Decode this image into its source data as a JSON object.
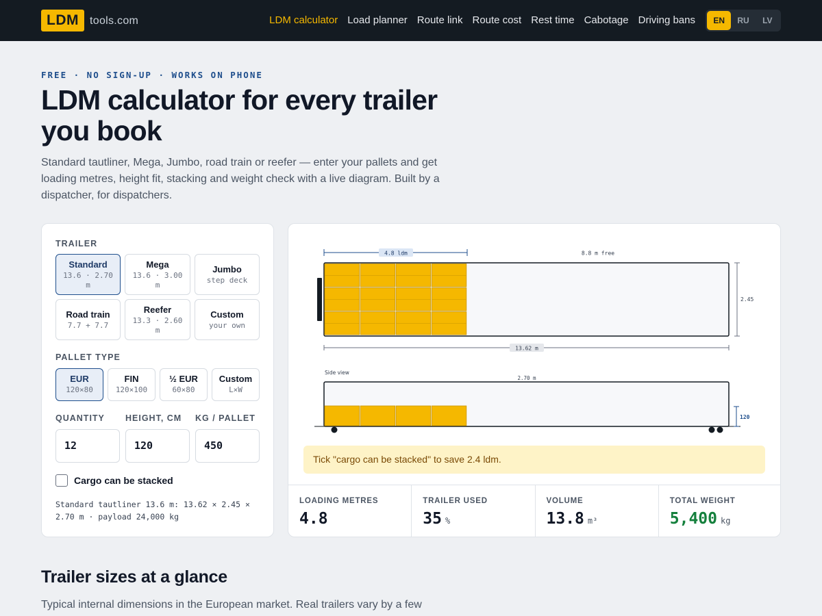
{
  "brand": {
    "logo": "LDM",
    "suffix": "tools.com"
  },
  "nav": {
    "links": [
      "LDM calculator",
      "Load planner",
      "Route link",
      "Route cost",
      "Rest time",
      "Cabotage",
      "Driving bans"
    ],
    "active_index": 0
  },
  "lang": {
    "options": [
      "EN",
      "RU",
      "LV"
    ],
    "selected": "EN"
  },
  "hero": {
    "eyebrow": "FREE · NO SIGN-UP · WORKS ON PHONE",
    "title": "LDM calculator for every trailer you book",
    "lead": "Standard tautliner, Mega, Jumbo, road train or reefer — enter your pallets and get loading metres, height fit, stacking and weight check with a live diagram. Built by a dispatcher, for dispatchers."
  },
  "form": {
    "trailer_label": "TRAILER",
    "trailers": [
      {
        "name": "Standard",
        "spec": "13.6 · 2.70 m",
        "selected": true
      },
      {
        "name": "Mega",
        "spec": "13.6 · 3.00 m",
        "selected": false
      },
      {
        "name": "Jumbo",
        "spec": "step deck",
        "selected": false
      },
      {
        "name": "Road train",
        "spec": "7.7 + 7.7",
        "selected": false
      },
      {
        "name": "Reefer",
        "spec": "13.3 · 2.60 m",
        "selected": false
      },
      {
        "name": "Custom",
        "spec": "your own",
        "selected": false
      }
    ],
    "pallet_label": "PALLET TYPE",
    "pallets": [
      {
        "name": "EUR",
        "spec": "120×80",
        "selected": true
      },
      {
        "name": "FIN",
        "spec": "120×100",
        "selected": false
      },
      {
        "name": "½ EUR",
        "spec": "60×80",
        "selected": false
      },
      {
        "name": "Custom",
        "spec": "L×W",
        "selected": false
      }
    ],
    "quantity_label": "QUANTITY",
    "quantity": "12",
    "height_label": "HEIGHT, CM",
    "height": "120",
    "weight_label": "KG / PALLET",
    "weight": "450",
    "stack_label": "Cargo can be stacked",
    "stack_checked": false,
    "spec_text": "Standard tautliner 13.6 m: 13.62 × 2.45 × 2.70 m · payload 24,000 kg"
  },
  "diagram": {
    "top_used_label": "4.8 ldm",
    "top_free_label": "8.8 m free",
    "width_label": "2.45",
    "length_label": "13.62 m",
    "side_title": "Side view",
    "side_height_label": "2.70 m",
    "cargo_height_label": "120",
    "pallet_columns": 4,
    "pallet_rows": 3,
    "used_ldm": 4.8,
    "trailer_length_m": 13.62,
    "pallet_color": "#f5b800"
  },
  "tip": "Tick \"cargo can be stacked\" to save 2.4 ldm.",
  "stats": [
    {
      "label": "LOADING METRES",
      "value": "4.8",
      "unit": ""
    },
    {
      "label": "TRAILER USED",
      "value": "35",
      "unit": "%"
    },
    {
      "label": "VOLUME",
      "value": "13.8",
      "unit": "m³"
    },
    {
      "label": "TOTAL WEIGHT",
      "value": "5,400",
      "unit": "kg"
    }
  ],
  "section": {
    "title": "Trailer sizes at a glance",
    "subtitle": "Typical internal dimensions in the European market. Real trailers vary by a few"
  },
  "colors": {
    "accent": "#f5b800",
    "nav_bg": "#141b22",
    "primary": "#1e4e8c",
    "positive": "#15803d"
  }
}
